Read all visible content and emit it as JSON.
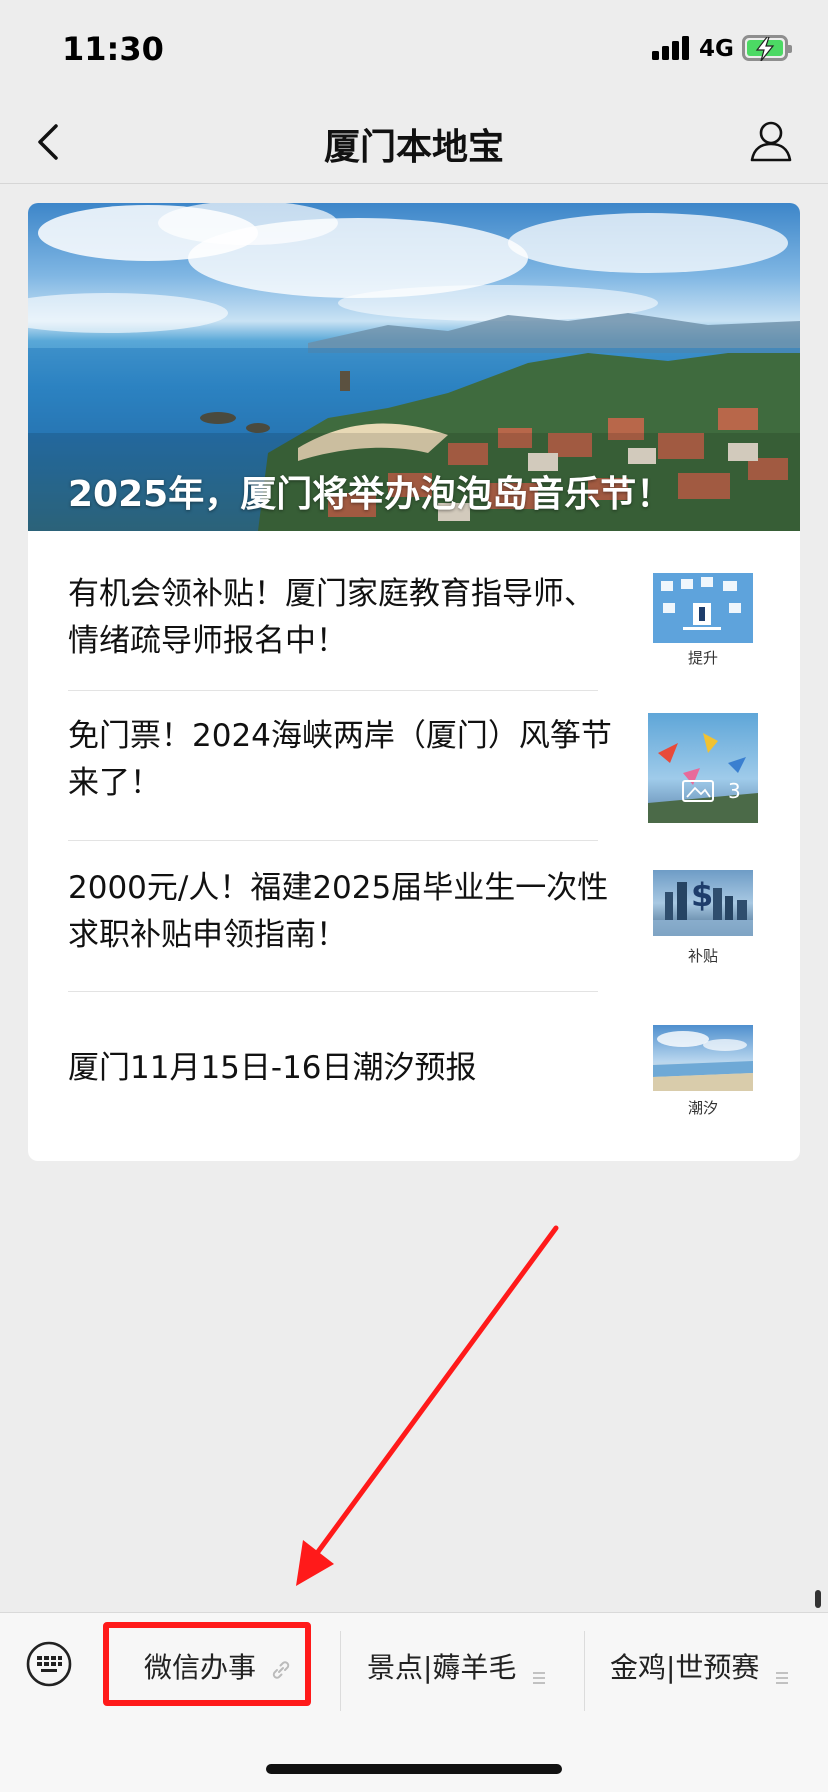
{
  "status_bar": {
    "time": "11:30",
    "network": "4G"
  },
  "nav": {
    "title": "厦门本地宝",
    "back_icon": "back-chevron-icon",
    "profile_icon": "user-profile-icon"
  },
  "card": {
    "hero": {
      "caption": "2025年，厦门将举办泡泡岛音乐节！"
    },
    "articles": [
      {
        "title": "有机会领补贴！厦门家庭教育指导师、情绪疏导师报名中！",
        "thumb_label": "提升"
      },
      {
        "title": "免门票！2024海峡两岸（厦门）风筝节来了！",
        "thumb_badge": "3"
      },
      {
        "title": "2000元/人！福建2025届毕业生一次性求职补贴申领指南！",
        "thumb_label": "补贴"
      },
      {
        "title": "厦门11月15日-16日潮汐预报",
        "thumb_label": "潮汐"
      }
    ]
  },
  "menu": {
    "keyboard_icon": "keyboard-icon",
    "items": [
      {
        "label": "微信办事",
        "icon": "link-icon"
      },
      {
        "label": "景点|薅羊毛",
        "icon": "list-icon"
      },
      {
        "label": "金鸡|世预赛",
        "icon": "list-icon"
      }
    ]
  },
  "colors": {
    "highlight": "#ff1a1a",
    "arrow": "#ff1a1a",
    "background": "#ededed"
  }
}
